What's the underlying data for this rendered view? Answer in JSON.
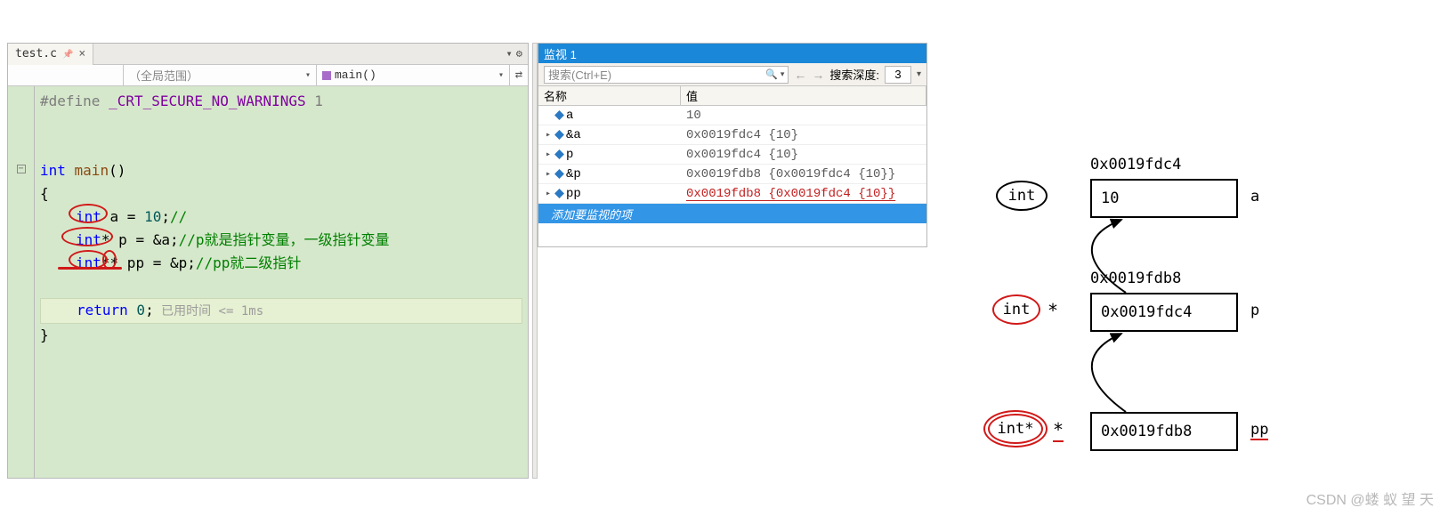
{
  "tab": {
    "filename": "test.c",
    "close": "×"
  },
  "nav": {
    "scope_placeholder": "（全局范围）",
    "member": "main()"
  },
  "code": {
    "l1_pre": "#define ",
    "l1_macro": "_CRT_SECURE_NO_WARNINGS",
    "l1_tail": " 1",
    "l4_kw": "int",
    "l4_func": " main",
    "l4_paren": "()",
    "l5_brace": "{",
    "l6_kw": "int",
    "l6_rest": " a = ",
    "l6_num": "10",
    "l6_semi": ";",
    "l6_cmt": "//",
    "l7_kw": "int",
    "l7_star": "*",
    "l7_rest1": " p = &a;",
    "l7_cmt": "//p就是指针变量，一级指针变量",
    "l8_kw": "int",
    "l8_star": "**",
    "l8_rest1": " pp = &p;",
    "l8_cmt": "//pp就二级指针",
    "l10_kw": "return",
    "l10_num": " 0",
    "l10_semi": ";",
    "l10_ghost": "  已用时间 <= 1ms",
    "l11_brace": "}"
  },
  "watch": {
    "title": "监视 1",
    "search_placeholder": "搜索(Ctrl+E)",
    "depth_label": "搜索深度:",
    "depth_value": "3",
    "hdr_name": "名称",
    "hdr_value": "值",
    "rows": [
      {
        "exp": false,
        "name": "a",
        "value": "10",
        "red": false
      },
      {
        "exp": true,
        "name": "&a",
        "value": "0x0019fdc4 {10}",
        "red": false
      },
      {
        "exp": true,
        "name": "p",
        "value": "0x0019fdc4 {10}",
        "red": false
      },
      {
        "exp": true,
        "name": "&p",
        "value": "0x0019fdb8 {0x0019fdc4 {10}}",
        "red": false
      },
      {
        "exp": true,
        "name": "pp",
        "value": "0x0019fdb8 {0x0019fdc4 {10}}",
        "red": true
      }
    ],
    "add_prompt": "添加要监视的项"
  },
  "diagram": {
    "addr1": "0x0019fdc4",
    "val1": "10",
    "lab1": "a",
    "type1": "int",
    "addr2": "0x0019fdb8",
    "val2": "0x0019fdc4",
    "lab2": "p",
    "type2": "int",
    "val3": "0x0019fdb8",
    "lab3": "pp",
    "type3": "int*"
  },
  "watermark": "CSDN @蝼 蚁 望 天"
}
